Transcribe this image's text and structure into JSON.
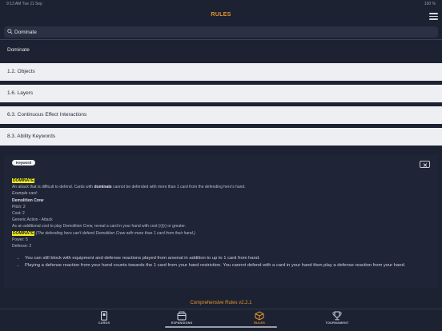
{
  "status": {
    "time": "9:13 AM  Tue 11 Sep",
    "battery": "100 %"
  },
  "header": {
    "title": "RULES"
  },
  "search": {
    "value": "Dominate",
    "placeholder": "Search"
  },
  "results": {
    "top": "Dominate",
    "items": [
      "1.2. Objects",
      "1.6. Layers",
      "6.3. Continuous Effect Interactions",
      "8.3. Ability Keywords"
    ]
  },
  "detail": {
    "badge": "Keyword",
    "keyword": "DOMINATE",
    "def_pre": "An attack that is difficult to defend. Cards with ",
    "def_bold": "dominate",
    "def_post": " cannot be defended with more than 1 card from the defending hero's hand.",
    "example_label": "Example card:",
    "card_name": "Demolition Crew",
    "pitch": "Pitch: 2",
    "cost": "Cost: 2",
    "type": "Generic Action - Attack",
    "text": "As an additional cost to play Demolition Crew, reveal a card in your hand with cost {r}{r} or greater.",
    "keyword2": "DOMINATE",
    "reminder": " (The defending hero can't defend Demolition Crew with more than 1 card from their hand.)",
    "power": "Power: 5",
    "defense": "Defense: 2",
    "bullets": [
      "You can still block with equipment and defense reactions played from arsenal in addition to up to 1 card from hand.",
      "Playing a defense reaction from your hand counts towards the 1 card from your hand restriction. You cannot defend with a card in your hand then play a defense reaction from your hand."
    ]
  },
  "footer": {
    "version": "Comprehensive Rules v2.2.1"
  },
  "tabs": [
    {
      "label": "CARDS",
      "icon": "cards-icon"
    },
    {
      "label": "EXPANSIONS",
      "icon": "box-icon"
    },
    {
      "label": "RULES",
      "icon": "rules-icon"
    },
    {
      "label": "TOURNAMENT",
      "icon": "trophy-icon"
    }
  ],
  "colors": {
    "accent": "#e8952a",
    "highlight": "#f4ee1c",
    "background": "#1c2232"
  }
}
